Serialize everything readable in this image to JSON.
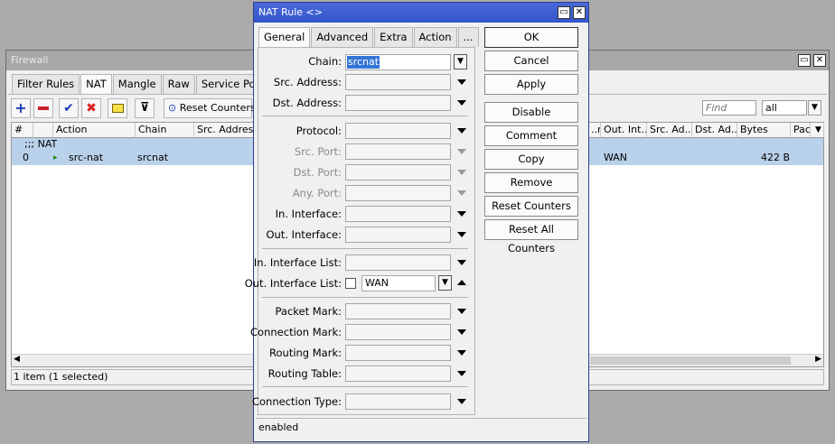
{
  "firewall": {
    "title": "Firewall",
    "tabs": [
      "Filter Rules",
      "NAT",
      "Mangle",
      "Raw",
      "Service Ports"
    ],
    "toolbar": {
      "reset_counters": "Reset Counters",
      "find_placeholder": "Find",
      "filter_value": "all"
    },
    "columns_left": [
      "#",
      "Action",
      "Chain",
      "Src. Address"
    ],
    "columns_right": [
      "..r",
      "Out. Int...",
      "Src. Ad...",
      "Dst. Ad...",
      "Bytes",
      "Pac"
    ],
    "group_row": ";;; NAT",
    "rows": [
      {
        "num": "0",
        "action": "src-nat",
        "chain": "srcnat",
        "out_int": "WAN",
        "bytes": "422 B"
      }
    ],
    "status": "1 item (1 selected)"
  },
  "dialog": {
    "title": "NAT Rule <>",
    "tabs": [
      "General",
      "Advanced",
      "Extra",
      "Action",
      "..."
    ],
    "buttons": [
      "OK",
      "Cancel",
      "Apply",
      "Disable",
      "Comment",
      "Copy",
      "Remove",
      "Reset Counters",
      "Reset All Counters"
    ],
    "fields": {
      "chain": {
        "label": "Chain:",
        "value": "srcnat"
      },
      "src_address": {
        "label": "Src. Address:"
      },
      "dst_address": {
        "label": "Dst. Address:"
      },
      "protocol": {
        "label": "Protocol:"
      },
      "src_port": {
        "label": "Src. Port:"
      },
      "dst_port": {
        "label": "Dst. Port:"
      },
      "any_port": {
        "label": "Any. Port:"
      },
      "in_interface": {
        "label": "In. Interface:"
      },
      "out_interface": {
        "label": "Out. Interface:"
      },
      "in_interface_list": {
        "label": "In. Interface List:"
      },
      "out_interface_list": {
        "label": "Out. Interface List:",
        "value": "WAN"
      },
      "packet_mark": {
        "label": "Packet Mark:"
      },
      "connection_mark": {
        "label": "Connection Mark:"
      },
      "routing_mark": {
        "label": "Routing Mark:"
      },
      "routing_table": {
        "label": "Routing Table:"
      },
      "connection_type": {
        "label": "Connection Type:"
      }
    },
    "status": "enabled"
  }
}
